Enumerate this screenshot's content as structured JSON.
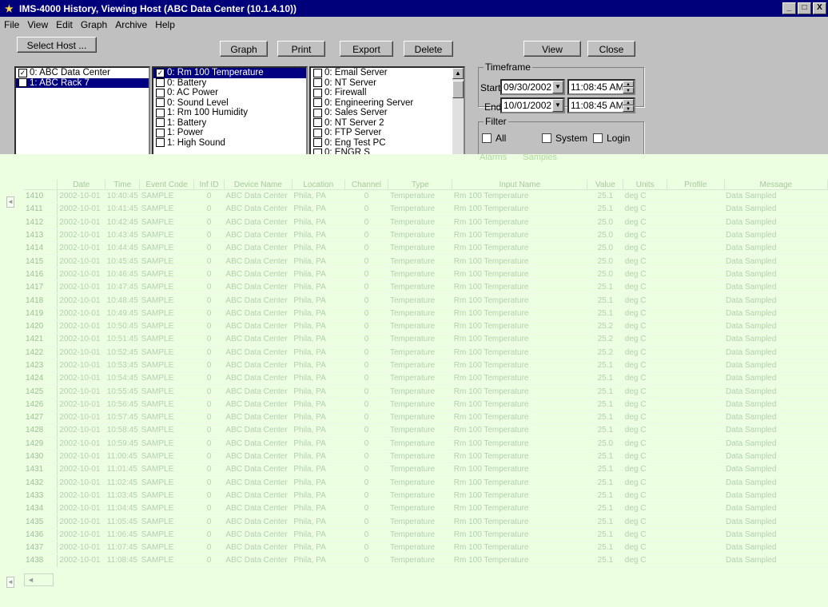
{
  "window": {
    "title": "IMS-4000 History, Viewing Host (ABC Data Center (10.1.4.10))",
    "controls": [
      "_",
      "□",
      "X"
    ]
  },
  "menu": [
    "File",
    "View",
    "Edit",
    "Graph",
    "Archive",
    "Help"
  ],
  "toolbar": {
    "select_host": "Select Host ...",
    "graph": "Graph",
    "print": "Print",
    "export": "Export",
    "delete": "Delete",
    "view": "View",
    "close": "Close"
  },
  "hosts": [
    {
      "label": "0: ABC Data Center",
      "checked": true,
      "selected": false
    },
    {
      "label": "1: ABC Rack 7",
      "checked": false,
      "selected": true
    }
  ],
  "inputs": [
    {
      "label": "0: Rm 100 Temperature",
      "checked": true,
      "selected": true
    },
    {
      "label": "0: Battery",
      "checked": false,
      "selected": false
    },
    {
      "label": "0: AC Power",
      "checked": false,
      "selected": false
    },
    {
      "label": "0: Sound Level",
      "checked": false,
      "selected": false
    },
    {
      "label": "1: Rm 100 Humidity",
      "checked": false,
      "selected": false
    },
    {
      "label": "1: Battery",
      "checked": false,
      "selected": false
    },
    {
      "label": "1: Power",
      "checked": false,
      "selected": false
    },
    {
      "label": "1: High Sound",
      "checked": false,
      "selected": false
    }
  ],
  "devices": [
    {
      "label": "0: Email Server",
      "checked": false
    },
    {
      "label": "0: NT Server",
      "checked": false
    },
    {
      "label": "0: Firewall",
      "checked": false
    },
    {
      "label": "0: Engineering Server",
      "checked": false
    },
    {
      "label": "0: Sales Server",
      "checked": false
    },
    {
      "label": "0: NT Server 2",
      "checked": false
    },
    {
      "label": "0: FTP Server",
      "checked": false
    },
    {
      "label": "0: Eng Test PC",
      "checked": false
    },
    {
      "label": "0: ENGR S",
      "checked": false
    }
  ],
  "timeframe": {
    "caption": "Timeframe",
    "start_label": "Start",
    "start_date": "09/30/2002",
    "start_time": "11:08:45 AM",
    "end_label": "End",
    "end_date": "10/01/2002",
    "end_time": "11:08:45 AM"
  },
  "filter": {
    "caption": "Filter",
    "all": "All",
    "system": "System",
    "login": "Login",
    "alarms": "Alarms",
    "samples": "Samples"
  },
  "grid": {
    "columns": [
      "",
      "Date",
      "Time",
      "Event Code",
      "Inf ID",
      "Device Name",
      "Location",
      "Channel",
      "Type",
      "Input Name",
      "Value",
      "Units",
      "Profile",
      "Message"
    ],
    "rows": [
      [
        "1410",
        "2002-10-01",
        "10:40:45",
        "SAMPLE",
        "0",
        "ABC Data Center",
        "Phila, PA",
        "0",
        "Temperature",
        "Rm 100 Temperature",
        "25.1",
        "deg C",
        "",
        "Data Sampled"
      ],
      [
        "1411",
        "2002-10-01",
        "10:41:45",
        "SAMPLE",
        "0",
        "ABC Data Center",
        "Phila, PA",
        "0",
        "Temperature",
        "Rm 100 Temperature",
        "25.1",
        "deg C",
        "",
        "Data Sampled"
      ],
      [
        "1412",
        "2002-10-01",
        "10:42:45",
        "SAMPLE",
        "0",
        "ABC Data Center",
        "Phila, PA",
        "0",
        "Temperature",
        "Rm 100 Temperature",
        "25.0",
        "deg C",
        "",
        "Data Sampled"
      ],
      [
        "1413",
        "2002-10-01",
        "10:43:45",
        "SAMPLE",
        "0",
        "ABC Data Center",
        "Phila, PA",
        "0",
        "Temperature",
        "Rm 100 Temperature",
        "25.0",
        "deg C",
        "",
        "Data Sampled"
      ],
      [
        "1414",
        "2002-10-01",
        "10:44:45",
        "SAMPLE",
        "0",
        "ABC Data Center",
        "Phila, PA",
        "0",
        "Temperature",
        "Rm 100 Temperature",
        "25.0",
        "deg C",
        "",
        "Data Sampled"
      ],
      [
        "1415",
        "2002-10-01",
        "10:45:45",
        "SAMPLE",
        "0",
        "ABC Data Center",
        "Phila, PA",
        "0",
        "Temperature",
        "Rm 100 Temperature",
        "25.0",
        "deg C",
        "",
        "Data Sampled"
      ],
      [
        "1416",
        "2002-10-01",
        "10:46:45",
        "SAMPLE",
        "0",
        "ABC Data Center",
        "Phila, PA",
        "0",
        "Temperature",
        "Rm 100 Temperature",
        "25.0",
        "deg C",
        "",
        "Data Sampled"
      ],
      [
        "1417",
        "2002-10-01",
        "10:47:45",
        "SAMPLE",
        "0",
        "ABC Data Center",
        "Phila, PA",
        "0",
        "Temperature",
        "Rm 100 Temperature",
        "25.1",
        "deg C",
        "",
        "Data Sampled"
      ],
      [
        "1418",
        "2002-10-01",
        "10:48:45",
        "SAMPLE",
        "0",
        "ABC Data Center",
        "Phila, PA",
        "0",
        "Temperature",
        "Rm 100 Temperature",
        "25.1",
        "deg C",
        "",
        "Data Sampled"
      ],
      [
        "1419",
        "2002-10-01",
        "10:49:45",
        "SAMPLE",
        "0",
        "ABC Data Center",
        "Phila, PA",
        "0",
        "Temperature",
        "Rm 100 Temperature",
        "25.1",
        "deg C",
        "",
        "Data Sampled"
      ],
      [
        "1420",
        "2002-10-01",
        "10:50:45",
        "SAMPLE",
        "0",
        "ABC Data Center",
        "Phila, PA",
        "0",
        "Temperature",
        "Rm 100 Temperature",
        "25.2",
        "deg C",
        "",
        "Data Sampled"
      ],
      [
        "1421",
        "2002-10-01",
        "10:51:45",
        "SAMPLE",
        "0",
        "ABC Data Center",
        "Phila, PA",
        "0",
        "Temperature",
        "Rm 100 Temperature",
        "25.2",
        "deg C",
        "",
        "Data Sampled"
      ],
      [
        "1422",
        "2002-10-01",
        "10:52:45",
        "SAMPLE",
        "0",
        "ABC Data Center",
        "Phila, PA",
        "0",
        "Temperature",
        "Rm 100 Temperature",
        "25.2",
        "deg C",
        "",
        "Data Sampled"
      ],
      [
        "1423",
        "2002-10-01",
        "10:53:45",
        "SAMPLE",
        "0",
        "ABC Data Center",
        "Phila, PA",
        "0",
        "Temperature",
        "Rm 100 Temperature",
        "25.1",
        "deg C",
        "",
        "Data Sampled"
      ],
      [
        "1424",
        "2002-10-01",
        "10:54:45",
        "SAMPLE",
        "0",
        "ABC Data Center",
        "Phila, PA",
        "0",
        "Temperature",
        "Rm 100 Temperature",
        "25.1",
        "deg C",
        "",
        "Data Sampled"
      ],
      [
        "1425",
        "2002-10-01",
        "10:55:45",
        "SAMPLE",
        "0",
        "ABC Data Center",
        "Phila, PA",
        "0",
        "Temperature",
        "Rm 100 Temperature",
        "25.1",
        "deg C",
        "",
        "Data Sampled"
      ],
      [
        "1426",
        "2002-10-01",
        "10:56:45",
        "SAMPLE",
        "0",
        "ABC Data Center",
        "Phila, PA",
        "0",
        "Temperature",
        "Rm 100 Temperature",
        "25.1",
        "deg C",
        "",
        "Data Sampled"
      ],
      [
        "1427",
        "2002-10-01",
        "10:57:45",
        "SAMPLE",
        "0",
        "ABC Data Center",
        "Phila, PA",
        "0",
        "Temperature",
        "Rm 100 Temperature",
        "25.1",
        "deg C",
        "",
        "Data Sampled"
      ],
      [
        "1428",
        "2002-10-01",
        "10:58:45",
        "SAMPLE",
        "0",
        "ABC Data Center",
        "Phila, PA",
        "0",
        "Temperature",
        "Rm 100 Temperature",
        "25.1",
        "deg C",
        "",
        "Data Sampled"
      ],
      [
        "1429",
        "2002-10-01",
        "10:59:45",
        "SAMPLE",
        "0",
        "ABC Data Center",
        "Phila, PA",
        "0",
        "Temperature",
        "Rm 100 Temperature",
        "25.0",
        "deg C",
        "",
        "Data Sampled"
      ],
      [
        "1430",
        "2002-10-01",
        "11:00:45",
        "SAMPLE",
        "0",
        "ABC Data Center",
        "Phila, PA",
        "0",
        "Temperature",
        "Rm 100 Temperature",
        "25.1",
        "deg C",
        "",
        "Data Sampled"
      ],
      [
        "1431",
        "2002-10-01",
        "11:01:45",
        "SAMPLE",
        "0",
        "ABC Data Center",
        "Phila, PA",
        "0",
        "Temperature",
        "Rm 100 Temperature",
        "25.1",
        "deg C",
        "",
        "Data Sampled"
      ],
      [
        "1432",
        "2002-10-01",
        "11:02:45",
        "SAMPLE",
        "0",
        "ABC Data Center",
        "Phila, PA",
        "0",
        "Temperature",
        "Rm 100 Temperature",
        "25.1",
        "deg C",
        "",
        "Data Sampled"
      ],
      [
        "1433",
        "2002-10-01",
        "11:03:45",
        "SAMPLE",
        "0",
        "ABC Data Center",
        "Phila, PA",
        "0",
        "Temperature",
        "Rm 100 Temperature",
        "25.1",
        "deg C",
        "",
        "Data Sampled"
      ],
      [
        "1434",
        "2002-10-01",
        "11:04:45",
        "SAMPLE",
        "0",
        "ABC Data Center",
        "Phila, PA",
        "0",
        "Temperature",
        "Rm 100 Temperature",
        "25.1",
        "deg C",
        "",
        "Data Sampled"
      ],
      [
        "1435",
        "2002-10-01",
        "11:05:45",
        "SAMPLE",
        "0",
        "ABC Data Center",
        "Phila, PA",
        "0",
        "Temperature",
        "Rm 100 Temperature",
        "25.1",
        "deg C",
        "",
        "Data Sampled"
      ],
      [
        "1436",
        "2002-10-01",
        "11:06:45",
        "SAMPLE",
        "0",
        "ABC Data Center",
        "Phila, PA",
        "0",
        "Temperature",
        "Rm 100 Temperature",
        "25.1",
        "deg C",
        "",
        "Data Sampled"
      ],
      [
        "1437",
        "2002-10-01",
        "11:07:45",
        "SAMPLE",
        "0",
        "ABC Data Center",
        "Phila, PA",
        "0",
        "Temperature",
        "Rm 100 Temperature",
        "25.1",
        "deg C",
        "",
        "Data Sampled"
      ],
      [
        "1438",
        "2002-10-01",
        "11:08:45",
        "SAMPLE",
        "0",
        "ABC Data Center",
        "Phila, PA",
        "0",
        "Temperature",
        "Rm 100 Temperature",
        "25.1",
        "deg C",
        "",
        "Data Sampled"
      ]
    ]
  }
}
